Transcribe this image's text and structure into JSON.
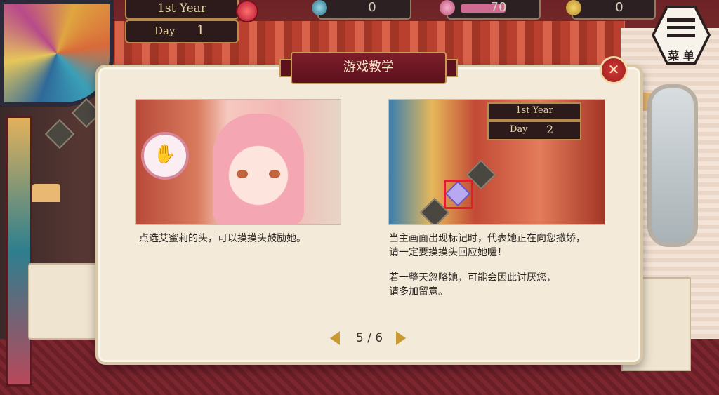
{
  "hud": {
    "year": "1st Year",
    "day_label": "Day",
    "day_value": "1",
    "resource_1": "0",
    "resource_2": "70",
    "resource_3": "0",
    "resource_2_fill": 0.7
  },
  "menu": {
    "label": "菜 单"
  },
  "dialog": {
    "title": "游戏教学",
    "close_icon": "close-icon",
    "left_caption": "点选艾蜜莉的头，可以摸摸头鼓励她。",
    "right_caption_1": "当主画面出现标记时，代表她正在向您撒娇，",
    "right_caption_2": "请一定要摸摸头回应她喔！",
    "right_caption_3": "若一整天忽略她，可能会因此讨厌您，",
    "right_caption_4": "请多加留意。",
    "mini_year": "1st Year",
    "mini_day_label": "Day",
    "mini_day_value": "2"
  },
  "pager": {
    "text": "5 / 6"
  },
  "colors": {
    "banner": "#7d1d2a",
    "alert_frame": "#e01f2a",
    "arrow": "#c99a33"
  }
}
